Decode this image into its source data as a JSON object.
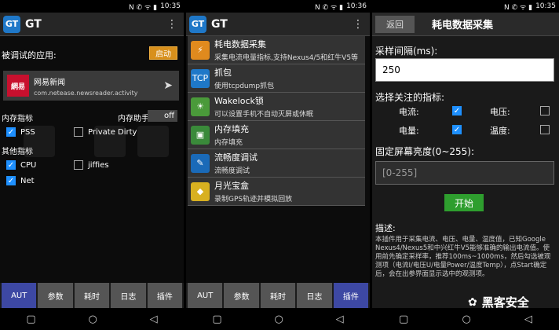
{
  "status": {
    "time1": "10:35",
    "time2": "10:36",
    "time3": "10:35",
    "glyphs": "N ✆ ᯤ ▮"
  },
  "app": {
    "logo": "GT",
    "title": "GT",
    "menu_icon": "more-vert-icon"
  },
  "p1": {
    "debug_label": "被调试的应用:",
    "start": "启动",
    "app_logo": "網易",
    "app_name": "网易新闻",
    "app_pkg": "com.netease.newsreader.activity",
    "mem_label": "内存指标",
    "mem_helper": "内存助手:",
    "toggle": "off",
    "pss": "PSS",
    "private_dirty": "Private Dirty",
    "other_label": "其他指标",
    "cpu": "CPU",
    "jiffies": "jiffies",
    "net": "Net"
  },
  "tabs": [
    "AUT",
    "参数",
    "耗时",
    "日志",
    "插件"
  ],
  "p2": {
    "items": [
      {
        "title": "耗电数据采集",
        "sub": "采集电流电量指标,支持Nexus4/5和红牛V5等",
        "icon": "battery-icon",
        "color": "#e08a1e",
        "glyph": "⚡"
      },
      {
        "title": "抓包",
        "sub": "使用tcpdump抓包",
        "icon": "packet-capture-icon",
        "color": "#1e78c8",
        "glyph": "TCP"
      },
      {
        "title": "Wakelock锁",
        "sub": "可以设置手机不自动灭屏或休眠",
        "icon": "wakelock-icon",
        "color": "#4a9a3a",
        "glyph": "☀"
      },
      {
        "title": "内存填充",
        "sub": "内存填充",
        "icon": "memory-fill-icon",
        "color": "#3a8a3a",
        "glyph": "▣"
      },
      {
        "title": "流畅度调试",
        "sub": "流畅度调试",
        "icon": "smoothness-icon",
        "color": "#1a6ab8",
        "glyph": "✎"
      },
      {
        "title": "月光宝盒",
        "sub": "录制GPS轨迹并模拟回放",
        "icon": "gps-box-icon",
        "color": "#d8b020",
        "glyph": "◆"
      }
    ]
  },
  "p3": {
    "back": "返回",
    "title": "耗电数据采集",
    "interval_label": "采样间隔(ms):",
    "interval_value": "250",
    "focus_label": "选择关注的指标:",
    "current": "电流:",
    "voltage": "电压:",
    "capacity": "电量:",
    "temp": "温度:",
    "brightness_label": "固定屏幕亮度(0~255):",
    "brightness_placeholder": "[0-255]",
    "start_button": "开始",
    "desc_label": "描述:",
    "desc": "本插件用于采集电流、电压、电量、温度值，已知Google Nexus4/Nexus5和中兴红牛V5能够准确的输出电流值。使用前先确定采样率，推荐100ms~1000ms，然后勾选被观测项（电流I/电压U/电量Power/温度Temp），点Start确定后，会在出参界面显示选中的观测项。",
    "watermark": "黑客安全"
  },
  "nav": {
    "recent": "▢",
    "home": "○",
    "back": "◁"
  }
}
